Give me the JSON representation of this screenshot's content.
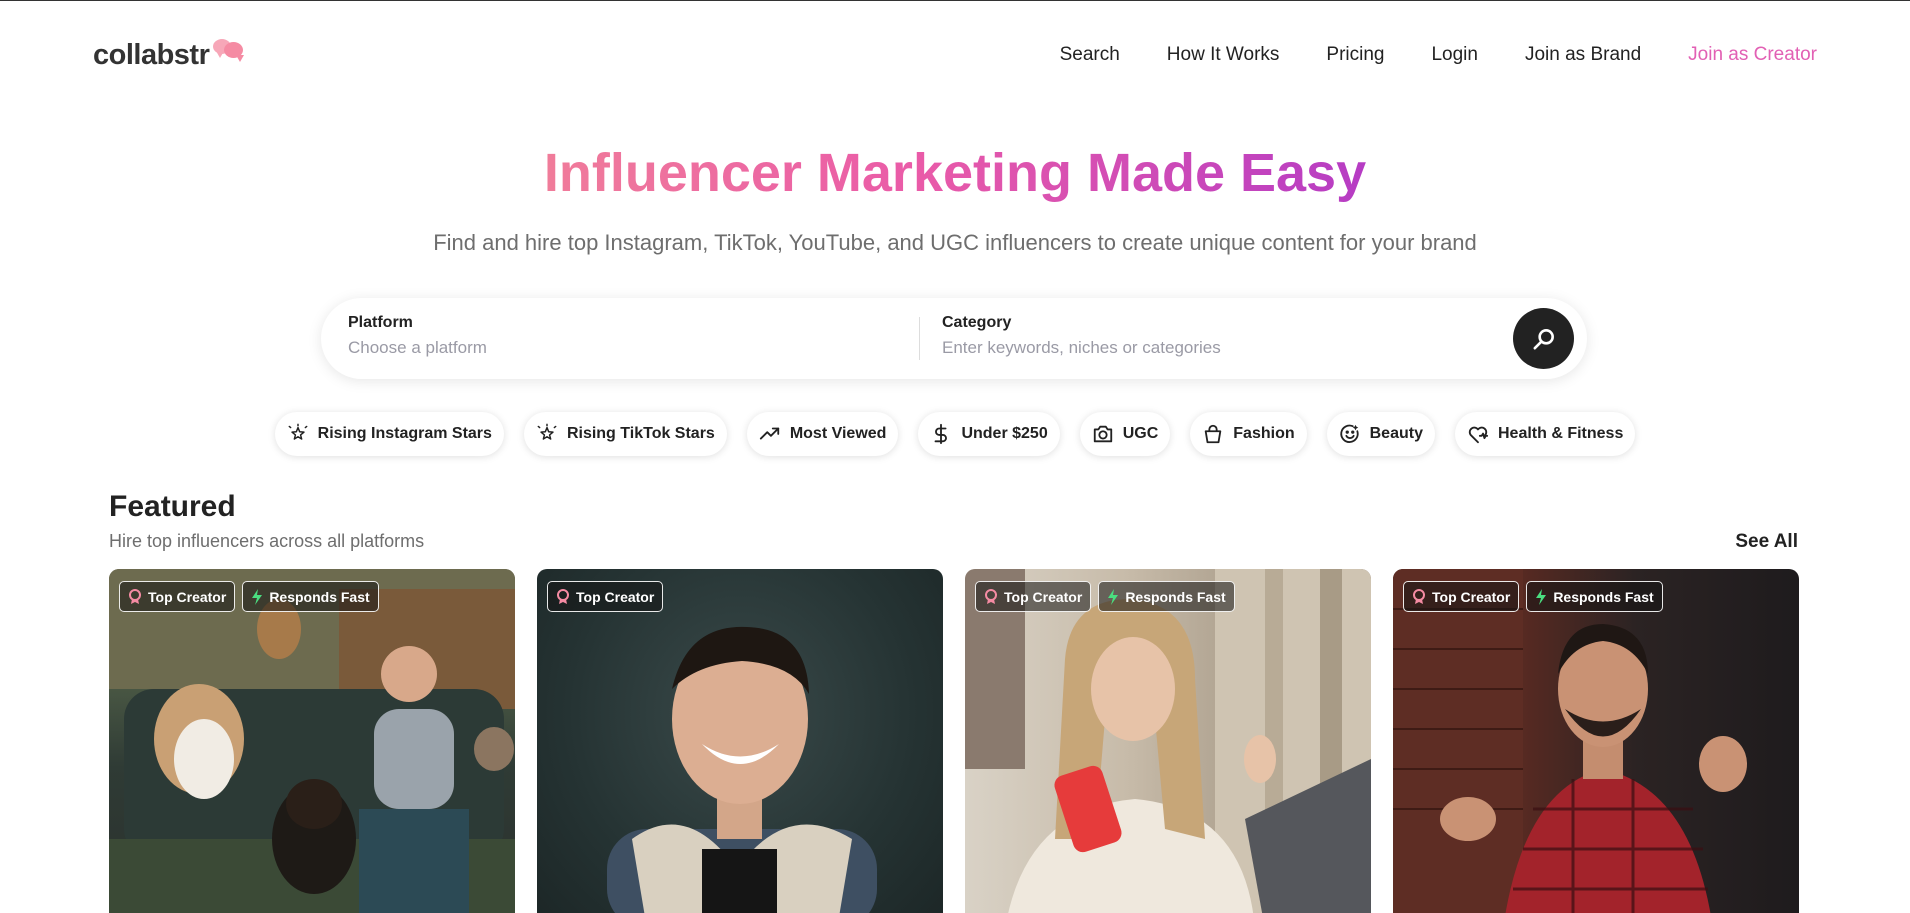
{
  "brand": {
    "name": "collabstr"
  },
  "nav": {
    "items": [
      {
        "label": "Search"
      },
      {
        "label": "How It Works"
      },
      {
        "label": "Pricing"
      },
      {
        "label": "Login"
      },
      {
        "label": "Join as Brand"
      },
      {
        "label": "Join as Creator"
      }
    ],
    "accent_color": "#e260b4"
  },
  "hero": {
    "title": "Influencer Marketing Made Easy",
    "subtitle": "Find and hire top Instagram, TikTok, YouTube, and UGC influencers to create unique content for your brand"
  },
  "search": {
    "platform_label": "Platform",
    "platform_placeholder": "Choose a platform",
    "category_label": "Category",
    "category_placeholder": "Enter keywords, niches or categories"
  },
  "chips": [
    {
      "label": "Rising Instagram Stars",
      "icon": "sparkle-icon"
    },
    {
      "label": "Rising TikTok Stars",
      "icon": "sparkle-icon"
    },
    {
      "label": "Most Viewed",
      "icon": "trending-up-icon"
    },
    {
      "label": "Under $250",
      "icon": "dollar-icon"
    },
    {
      "label": "UGC",
      "icon": "camera-icon"
    },
    {
      "label": "Fashion",
      "icon": "shopping-bag-icon"
    },
    {
      "label": "Beauty",
      "icon": "smile-icon"
    },
    {
      "label": "Health & Fitness",
      "icon": "heart-pulse-icon"
    }
  ],
  "featured": {
    "title": "Featured",
    "subtitle": "Hire top influencers across all platforms",
    "see_all": "See All",
    "cards": [
      {
        "badges": [
          "Top Creator",
          "Responds Fast"
        ]
      },
      {
        "badges": [
          "Top Creator"
        ]
      },
      {
        "badges": [
          "Top Creator",
          "Responds Fast"
        ]
      },
      {
        "badges": [
          "Top Creator",
          "Responds Fast"
        ]
      }
    ]
  }
}
